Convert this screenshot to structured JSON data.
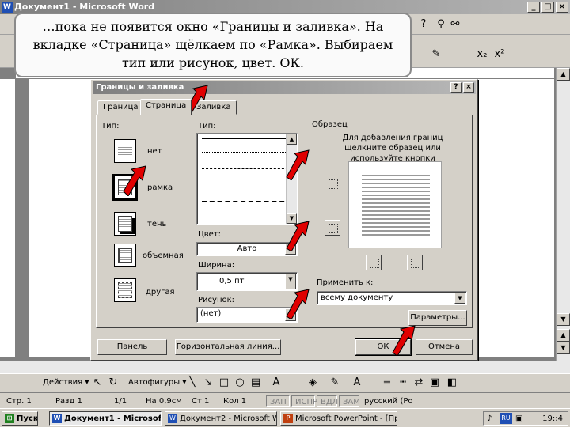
{
  "window": {
    "title": "Документ1 - Microsoft Word",
    "min": "_",
    "max": "□",
    "close": "×"
  },
  "annotation": "…пока не появится окно «Границы и заливка». На вкладке «Страница» щёлкаем по «Рамка». Выбираем тип или рисунок, цвет. ОК.",
  "dialog": {
    "title": "Границы и заливка",
    "help": "?",
    "close": "×",
    "tabs": [
      "Граница",
      "Страница",
      "Заливка"
    ],
    "active_tab": "Страница",
    "setting_label": "Тип:",
    "settings": [
      "нет",
      "рамка",
      "тень",
      "объемная",
      "другая"
    ],
    "style_label": "Тип:",
    "color_label": "Цвет:",
    "color_value": "Авто",
    "width_label": "Ширина:",
    "width_value": "0,5 пт",
    "art_label": "Рисунок:",
    "art_value": "(нет)",
    "preview_label": "Образец",
    "preview_hint": "Для добавления границ щелкните образец или используйте кнопки",
    "apply_label": "Применить к:",
    "apply_value": "всему документу",
    "options_button": "Параметры...",
    "toolbar_button": "Панель",
    "hline_button": "Горизонтальная линия...",
    "ok_button": "ОК",
    "cancel_button": "Отмена"
  },
  "toolbar2": {
    "sub": "x₂",
    "sup": "x²"
  },
  "drawbar": {
    "actions": "Действия ▾",
    "autoshapes": "Автофигуры ▾"
  },
  "status": {
    "page": "Стр. 1",
    "section": "Разд 1",
    "pages": "1/1",
    "at": "На 0,9см",
    "line": "Ст 1",
    "col": "Кол 1",
    "rec": "ЗАП",
    "trk": "ИСПР",
    "ext": "ВДЛ",
    "ovr": "ЗАМ",
    "lang": "русский (Ро"
  },
  "taskbar": {
    "start": "Пуск",
    "tasks": [
      "Документ1 - Microsof...",
      "Документ2 - Microsoft Word",
      "Microsoft PowerPoint - [Пре..."
    ],
    "clock": "19::4",
    "lang": "RU"
  },
  "colors": {
    "arrow_red": "#e00000",
    "titlebar": "#7f7f7f"
  }
}
